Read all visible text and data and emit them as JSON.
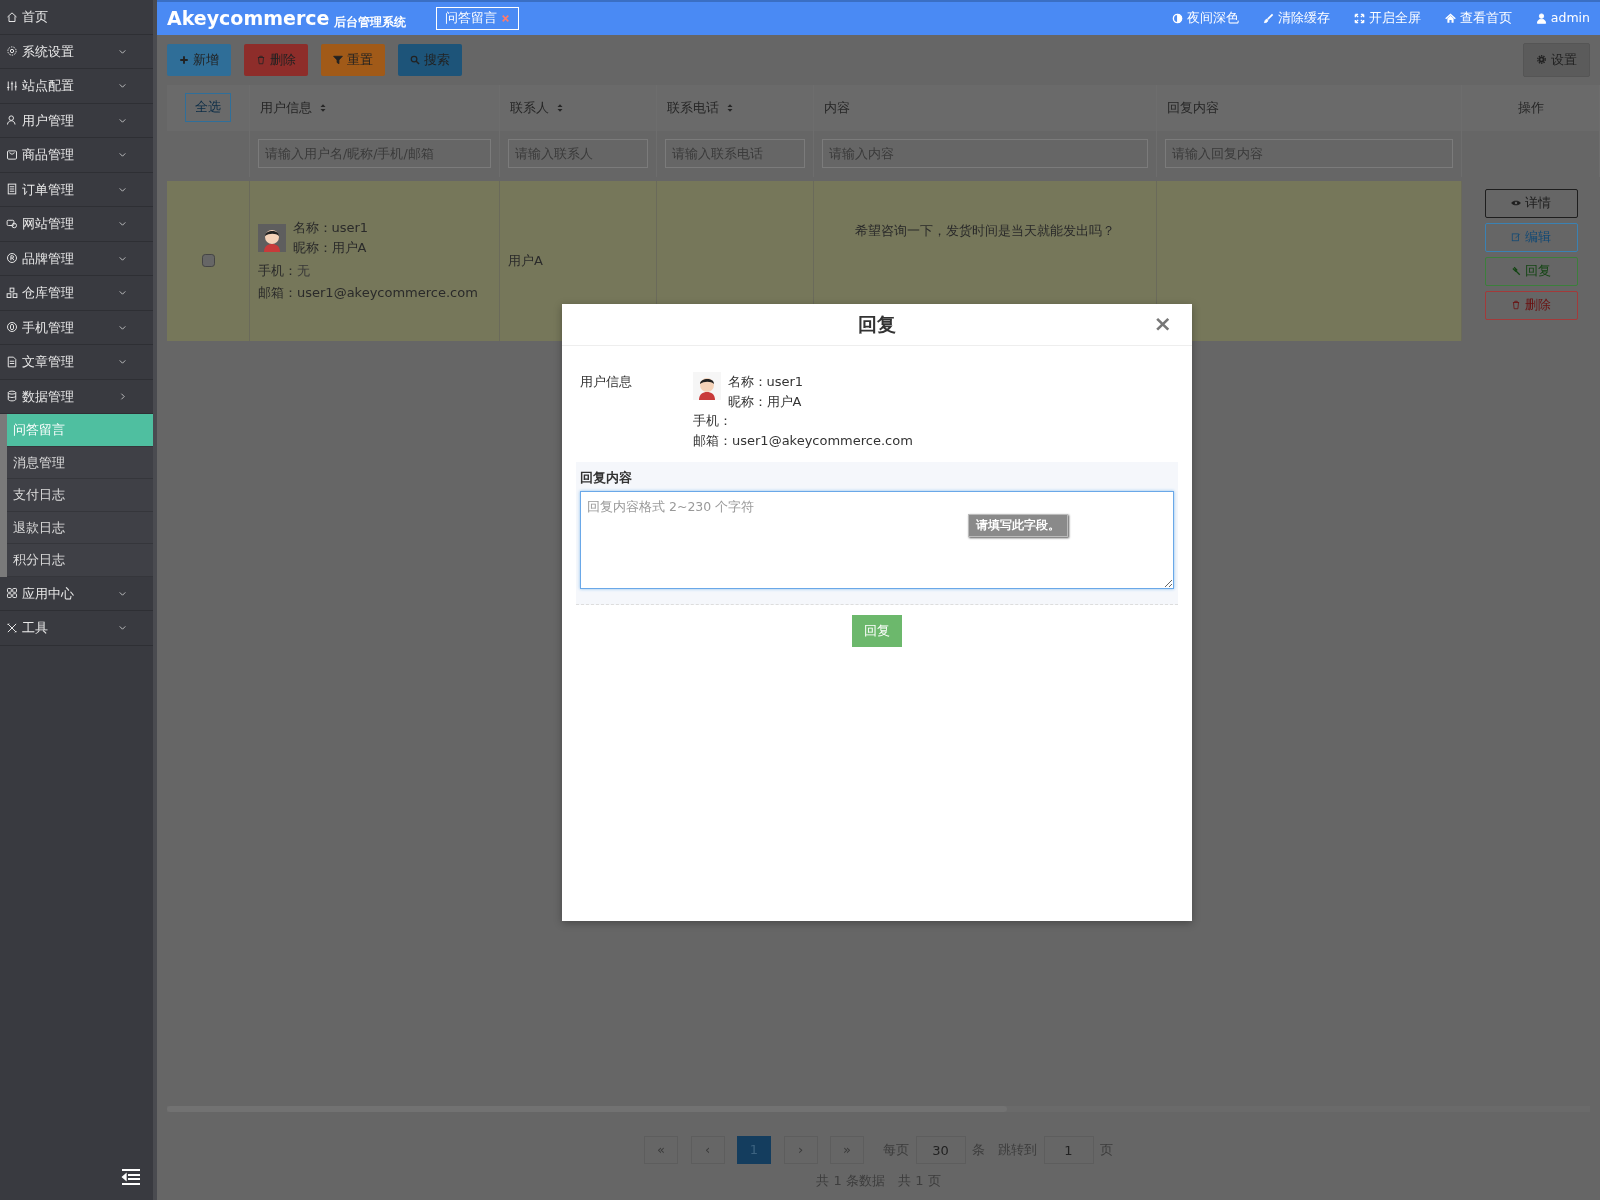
{
  "sidebar": {
    "items": [
      {
        "label": "首页",
        "kind": "link"
      },
      {
        "label": "系统设置",
        "kind": "menu",
        "expanded": false
      },
      {
        "label": "站点配置",
        "kind": "menu",
        "expanded": false
      },
      {
        "label": "用户管理",
        "kind": "menu",
        "expanded": false
      },
      {
        "label": "商品管理",
        "kind": "menu",
        "expanded": false
      },
      {
        "label": "订单管理",
        "kind": "menu",
        "expanded": false
      },
      {
        "label": "网站管理",
        "kind": "menu",
        "expanded": false
      },
      {
        "label": "品牌管理",
        "kind": "menu",
        "expanded": false
      },
      {
        "label": "仓库管理",
        "kind": "menu",
        "expanded": false
      },
      {
        "label": "手机管理",
        "kind": "menu",
        "expanded": false
      },
      {
        "label": "文章管理",
        "kind": "menu",
        "expanded": false
      },
      {
        "label": "数据管理",
        "kind": "menu",
        "expanded": true,
        "children": [
          {
            "label": "问答留言",
            "selected": true
          },
          {
            "label": "消息管理",
            "selected": false
          },
          {
            "label": "支付日志",
            "selected": false
          },
          {
            "label": "退款日志",
            "selected": false
          },
          {
            "label": "积分日志",
            "selected": false
          }
        ]
      },
      {
        "label": "应用中心",
        "kind": "menu",
        "expanded": false
      },
      {
        "label": "工具",
        "kind": "menu",
        "expanded": false
      }
    ]
  },
  "topbar": {
    "brand": "Akeycommerce",
    "subtitle": "后台管理系统",
    "tabs": [
      {
        "label": "问答留言",
        "selected": true
      }
    ],
    "links": [
      {
        "label": "夜间深色",
        "kind": "theme"
      },
      {
        "label": "清除缓存",
        "kind": "brush"
      },
      {
        "label": "开启全屏",
        "kind": "fullscreen"
      },
      {
        "label": "查看首页",
        "kind": "home"
      },
      {
        "label": "admin",
        "kind": "user"
      }
    ]
  },
  "toolbar": {
    "buttons": [
      {
        "label": "新增",
        "kind": "add"
      },
      {
        "label": "删除",
        "kind": "delete"
      },
      {
        "label": "重置",
        "kind": "reset"
      },
      {
        "label": "搜索",
        "kind": "search"
      }
    ],
    "settings": "设置"
  },
  "table": {
    "select_all": "全选",
    "columns": [
      {
        "label": "用户信息",
        "sortable": true,
        "placeholder": "请输入用户名/昵称/手机/邮箱"
      },
      {
        "label": "联系人",
        "sortable": true,
        "placeholder": "请输入联系人"
      },
      {
        "label": "联系电话",
        "sortable": true,
        "placeholder": "请输入联系电话"
      },
      {
        "label": "内容",
        "sortable": false,
        "placeholder": "请输入内容"
      },
      {
        "label": "回复内容",
        "sortable": false,
        "placeholder": "请输入回复内容"
      },
      {
        "label": "操作",
        "sortable": false
      }
    ],
    "rows": [
      {
        "checked": false,
        "highlighted": true,
        "name": "名称：user1",
        "nickname": "昵称：用户A",
        "phone_label": "手机：",
        "phone_value": "无",
        "email": "邮箱：user1@akeycommerce.com",
        "contact": "用户A",
        "content": "希望咨询一下，发货时间是当天就能发出吗？",
        "actions": [
          {
            "label": "详情",
            "kind": "view"
          },
          {
            "label": "编辑",
            "kind": "edit"
          },
          {
            "label": "回复",
            "kind": "reply"
          },
          {
            "label": "删除",
            "kind": "delete"
          }
        ]
      }
    ]
  },
  "pagination": {
    "buttons": [
      {
        "label": "«",
        "selected": false
      },
      {
        "label": "‹",
        "selected": false
      },
      {
        "label": "1",
        "selected": true
      },
      {
        "label": "›",
        "selected": false
      },
      {
        "label": "»",
        "selected": false
      }
    ],
    "per_page_label": "每页",
    "per_page": "30",
    "per_page_unit": "条",
    "jump_label": "跳转到",
    "jump_page": "1",
    "jump_unit": "页",
    "total_records": "共 1 条数据",
    "total_pages": "共 1 页"
  },
  "modal": {
    "title": "回复",
    "close": "×",
    "user_label": "用户信息",
    "name": "名称：user1",
    "nickname": "昵称：用户A",
    "phone": "手机：",
    "email": "邮箱：user1@akeycommerce.com",
    "reply_label": "回复内容",
    "reply_placeholder": "回复内容格式 2~230 个字符",
    "validation_tip": "请填写此字段。",
    "submit": "回复"
  }
}
